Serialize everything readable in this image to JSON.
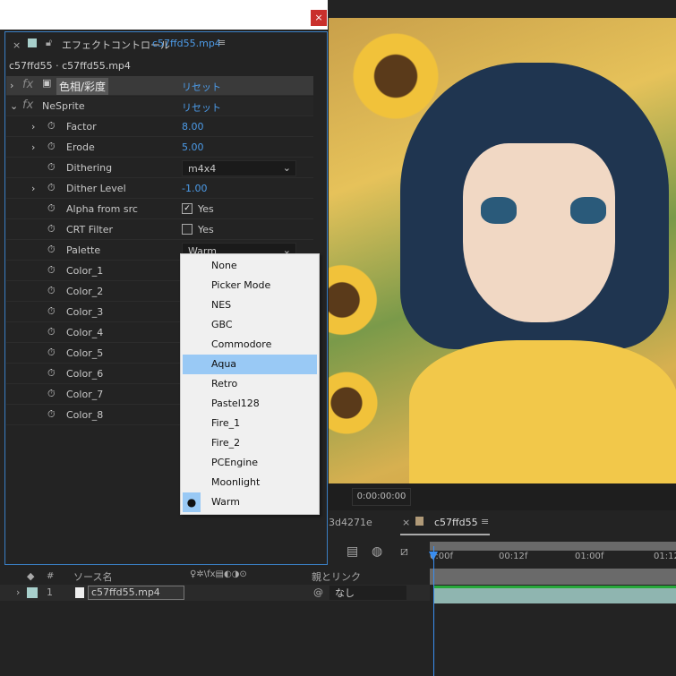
{
  "window": {
    "close_label": "×"
  },
  "panel": {
    "title": "エフェクトコントロール",
    "title_file": "c57ffd55.mp4",
    "path": "c57ffd55 · c57ffd55.mp4",
    "menu_icon": "≡"
  },
  "effects": [
    {
      "name": "色相/彩度",
      "reset": "リセット"
    },
    {
      "name": "NeSprite",
      "reset": "リセット"
    }
  ],
  "params": [
    {
      "label": "Factor",
      "value": "8.00",
      "type": "num",
      "expand": true
    },
    {
      "label": "Erode",
      "value": "5.00",
      "type": "num",
      "expand": true
    },
    {
      "label": "Dithering",
      "value": "m4x4",
      "type": "dropdown",
      "expand": false
    },
    {
      "label": "Dither Level",
      "value": "-1.00",
      "type": "num",
      "expand": true
    },
    {
      "label": "Alpha from src",
      "value": "Yes",
      "type": "check",
      "checked": true
    },
    {
      "label": "CRT Filter",
      "value": "Yes",
      "type": "check",
      "checked": false
    },
    {
      "label": "Palette",
      "value": "Warm",
      "type": "dropdown"
    },
    {
      "label": "Color_1"
    },
    {
      "label": "Color_2"
    },
    {
      "label": "Color_3"
    },
    {
      "label": "Color_4"
    },
    {
      "label": "Color_5"
    },
    {
      "label": "Color_6"
    },
    {
      "label": "Color_7"
    },
    {
      "label": "Color_8"
    }
  ],
  "palette_menu": {
    "options": [
      "None",
      "Picker Mode",
      "NES",
      "GBC",
      "Commodore",
      "Aqua",
      "Retro",
      "Pastel128",
      "Fire_1",
      "Fire_2",
      "PCEngine",
      "Moonlight",
      "Warm"
    ],
    "hovered": "Aqua",
    "selected": "Warm"
  },
  "viewer": {
    "timecode": "0:00:00:00"
  },
  "timeline": {
    "tabs": [
      "3d4271e",
      "c57ffd55"
    ],
    "ruler": [
      "0:00f",
      "00:12f",
      "01:00f",
      "01:12"
    ],
    "headers": {
      "num": "#",
      "source": "ソース名",
      "parent": "親とリンク"
    },
    "layer": {
      "index": "1",
      "name": "c57ffd55.mp4",
      "parent": "なし"
    }
  },
  "colors": {
    "accent": "#4c9be8",
    "highlight": "#99c9f5",
    "close": "#c9302c"
  }
}
